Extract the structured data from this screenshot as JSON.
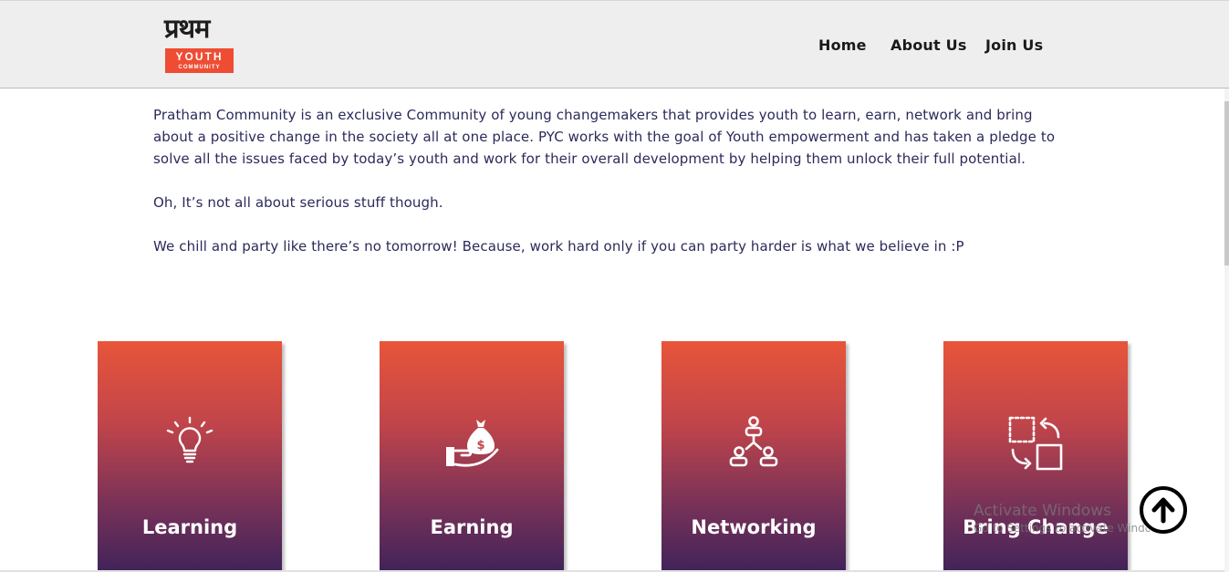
{
  "header": {
    "logo": {
      "hindi_text": "प्रथम",
      "youth_text": "YOUTH",
      "community_text": "COMMUNITY",
      "badge_color": "#ee4d34"
    },
    "nav": [
      {
        "label": "Home"
      },
      {
        "label": "About Us"
      },
      {
        "label": "Join Us"
      }
    ]
  },
  "content": {
    "paragraphs": [
      "Pratham Community is an exclusive Community of young changemakers that provides youth to learn, earn, network and bring about a positive change in the society all at one place. PYC works with the goal of Youth empowerment and has taken a pledge to solve all the issues faced by today’s youth and work for their overall development by helping them unlock their full potential.",
      "Oh, It’s not all about serious stuff though.",
      "We chill and party like there’s no tomorrow! Because, work hard only if you can party harder is what we believe in :P"
    ],
    "text_color": "#2b2a5b"
  },
  "cards": [
    {
      "label": "Learning",
      "icon": "lightbulb-icon"
    },
    {
      "label": "Earning",
      "icon": "money-bag-hand-icon"
    },
    {
      "label": "Networking",
      "icon": "network-people-icon"
    },
    {
      "label": "Bring Change",
      "icon": "transform-arrows-icon"
    }
  ],
  "card_gradient": {
    "top": "#e8553a",
    "bottom": "#40235a"
  },
  "watermark": {
    "title": "Activate Windows",
    "subtitle": "Go to Settings to activate Windows."
  },
  "scroll_top_icon": "arrow-up-circle-icon"
}
